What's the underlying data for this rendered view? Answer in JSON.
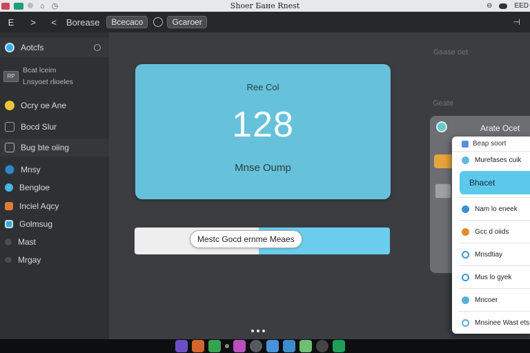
{
  "titlebar": {
    "title": "Shoer Бане Rnest",
    "right_text": "EED",
    "colors": {
      "close": "#c94a55",
      "green": "#1e9e78"
    },
    "left_icons": [
      "home-icon",
      "clock-icon"
    ],
    "right_icons": [
      "search-icon",
      "toggle-icon"
    ]
  },
  "toolbar": {
    "back_glyph": "E",
    "forward_glyph": ">",
    "prev_glyph": "<",
    "label": "Borease",
    "chip_1": "Bcecaco",
    "chip_2": "Gcaroer",
    "corner_glyph": "⊣"
  },
  "sidebar": {
    "items": [
      {
        "label": "Aotcfs",
        "color": "#39aee0"
      },
      {
        "label": "Bcat lceim",
        "sub": "Lnsyoet rlioeles",
        "badge": "RP"
      },
      {
        "label": "Ocry oe Ane",
        "color": "#e7c53a"
      },
      {
        "label": "Bocd Slur",
        "color": "#8a8d92"
      },
      {
        "label": "Bug bte oiing",
        "color": "#9fa3a8"
      },
      {
        "label": "Mnsy",
        "color": "#2f86c7"
      },
      {
        "label": "Bengloe",
        "color": "#45b7e6"
      },
      {
        "label": "Inciel Aqcy",
        "color": "#e07a34"
      },
      {
        "label": "Golmsug",
        "color": "#3fa6d6"
      },
      {
        "label": "Mast",
        "color": "#4a4c50"
      },
      {
        "label": "Mrgay",
        "color": "#4a4c50"
      }
    ]
  },
  "hero": {
    "heading": "Ree Col",
    "value": "128",
    "subtitle": "Mnse Oump",
    "color": "#66c2da"
  },
  "progress": {
    "label": "Mestc Gocd ernme Meaes",
    "fill_fraction": 0.514,
    "fill_color": "#6bcdee"
  },
  "right_labels": {
    "top": "Gsase oet",
    "middle": "Geate"
  },
  "panel": {
    "title": "Arate Ocet"
  },
  "dropdown": {
    "header": "Beap soort",
    "items": [
      {
        "label": "Murefases cuik",
        "color": "#62b8df"
      },
      {
        "label": "Bhacet",
        "highlight": true
      },
      {
        "label": "Nam lo eneek",
        "color": "#3a8fd4"
      },
      {
        "label": "Gcc d oiids",
        "color": "#e58b2f"
      },
      {
        "label": "Mnsdtiay",
        "color": "#3d98c9"
      },
      {
        "label": "Mus lo gyek",
        "color": "#3d98c9"
      },
      {
        "label": "Mncoer",
        "color": "#5aaed8"
      },
      {
        "label": "Mnsinee Wast ets",
        "color": "#5aaed8"
      }
    ]
  },
  "dock": {
    "icons": [
      {
        "name": "mail-app-icon",
        "color": "#6b4fc4"
      },
      {
        "name": "photos-app-icon",
        "color": "#d3652e"
      },
      {
        "name": "notes-app-icon",
        "color": "#36a34f"
      },
      {
        "name": "separator-icon",
        "color": "#888888"
      },
      {
        "name": "music-app-icon",
        "color": "#b94fbf"
      },
      {
        "name": "terminal-app-icon",
        "color": "#555a60"
      },
      {
        "name": "finder-app-icon",
        "color": "#4b90d9"
      },
      {
        "name": "preview-app-icon",
        "color": "#3c8ccc"
      },
      {
        "name": "maps-app-icon",
        "color": "#6fbf73"
      },
      {
        "name": "camera-app-icon",
        "color": "#444444"
      },
      {
        "name": "store-app-icon",
        "color": "#1f9e5a"
      }
    ]
  }
}
